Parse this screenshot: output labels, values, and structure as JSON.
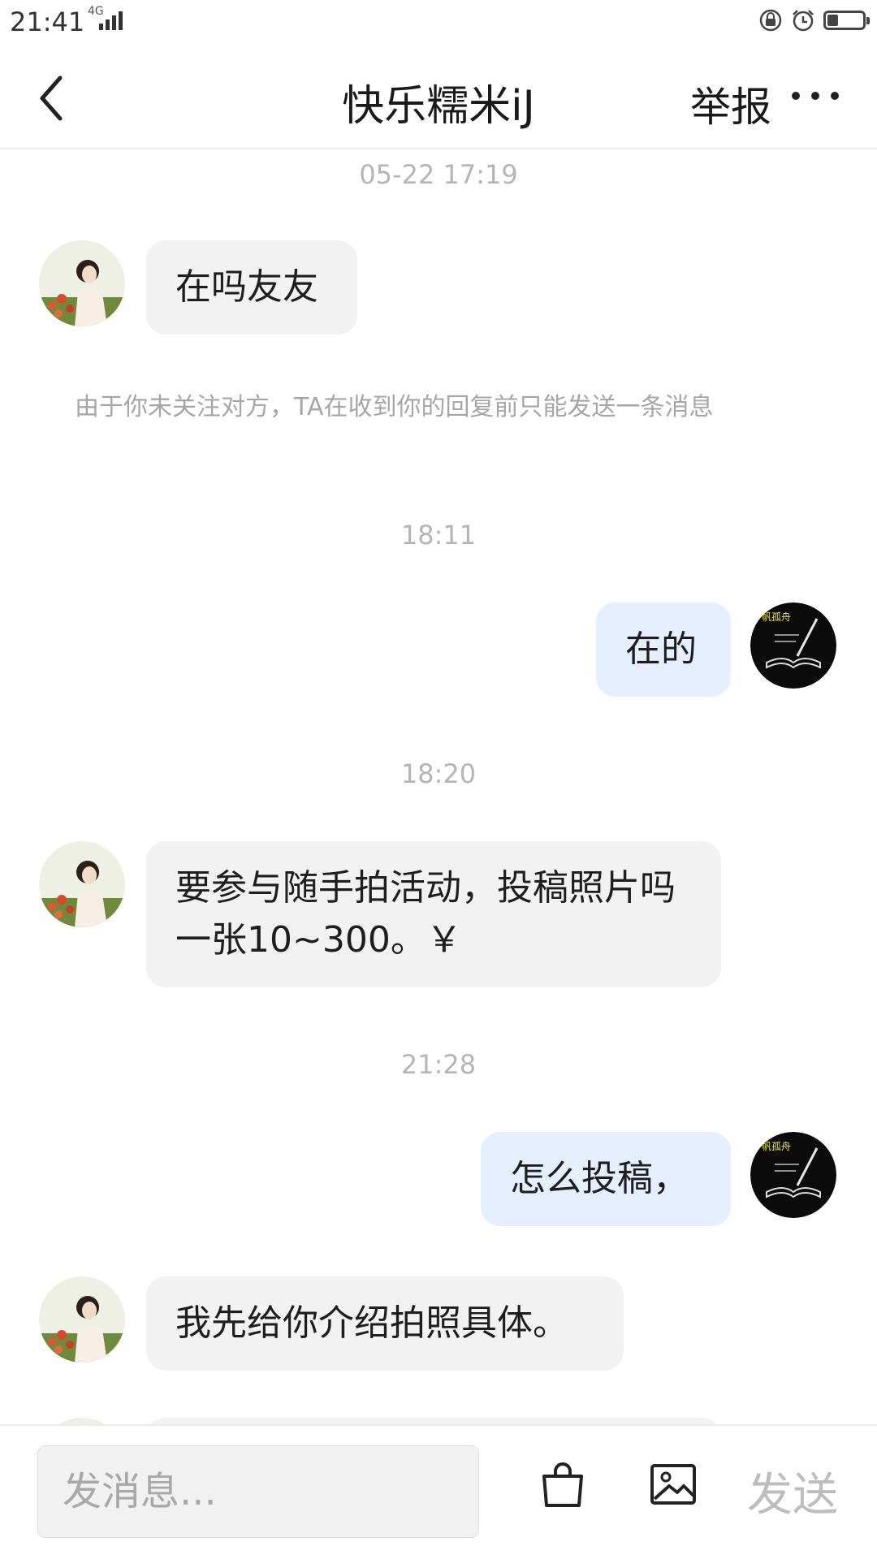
{
  "status_bar": {
    "time": "21:41",
    "network": "4G",
    "icons": [
      "lock-rotation-icon",
      "alarm-icon",
      "battery-icon"
    ],
    "battery_level": 0.3
  },
  "nav": {
    "title": "快乐糯米iJ",
    "report": "举报",
    "icons": [
      "back-arrow-icon",
      "more-dots-icon"
    ]
  },
  "messages": {
    "ts1": "05-22 17:19",
    "m1": "在吗友友",
    "notice": "由于你未关注对方，TA在收到你的回复前只能发送一条消息",
    "ts2": "18:11",
    "m2": "在的",
    "ts3": "18:20",
    "m3": "要参与随手拍活动，投稿照片吗一张10~300。￥",
    "ts4": "21:28",
    "m4": "怎么投稿，",
    "m5": "我先给你介绍拍照具体。"
  },
  "input": {
    "placeholder": "发消息...",
    "send": "发送",
    "icons": [
      "shopping-bag-icon",
      "image-icon"
    ]
  },
  "colors": {
    "incoming_bubble": "#f2f2f2",
    "outgoing_bubble": "#e5efff",
    "timestamp": "#b5b5b5",
    "notice": "#a6a6a6",
    "send_disabled": "#bdbdbd"
  }
}
